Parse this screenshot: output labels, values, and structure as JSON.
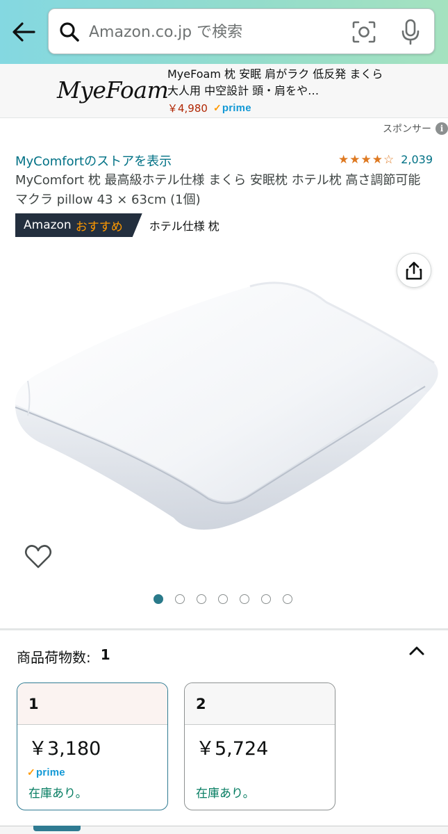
{
  "header": {
    "search_placeholder": "Amazon.co.jp で検索",
    "back_icon": "arrow-left-icon",
    "camera_icon": "camera-scan-icon",
    "mic_icon": "microphone-icon"
  },
  "ad": {
    "brand_logo": "MyeFoam",
    "title": "MyeFoam 枕 安眠 肩がラク 低反発 まくら 大人用 中空設計 頭・肩をや…",
    "price": "￥4,980",
    "prime": "prime"
  },
  "sponsored": {
    "label": "スポンサー",
    "info_glyph": "i"
  },
  "product": {
    "store_link": "MyComfortのストアを表示",
    "rating_value": 4.0,
    "rating_count": "2,039",
    "title": "MyComfort 枕 最高級ホテル仕様 まくら 安眠枕 ホテル枕 高さ調節可能 マクラ pillow 43 × 63cm (1個)",
    "badge_brand": "Amazon",
    "badge_choice": "おすすめ",
    "badge_category": "ホテル仕様 枕"
  },
  "gallery": {
    "image_count": 7,
    "active_index": 0
  },
  "quantity": {
    "label": "商品荷物数:",
    "value": "1",
    "options": [
      {
        "qty": "1",
        "price": "￥3,180",
        "prime": "prime",
        "stock": "在庫あり。",
        "selected": true
      },
      {
        "qty": "2",
        "price": "￥5,724",
        "prime": "",
        "stock": "在庫あり。",
        "selected": false
      }
    ]
  },
  "colors": {
    "link": "#007185",
    "star": "#de7921",
    "price_red": "#b12704",
    "stock_green": "#067d62",
    "prime_blue": "#1399d6",
    "selected_border": "#2f7b92"
  }
}
